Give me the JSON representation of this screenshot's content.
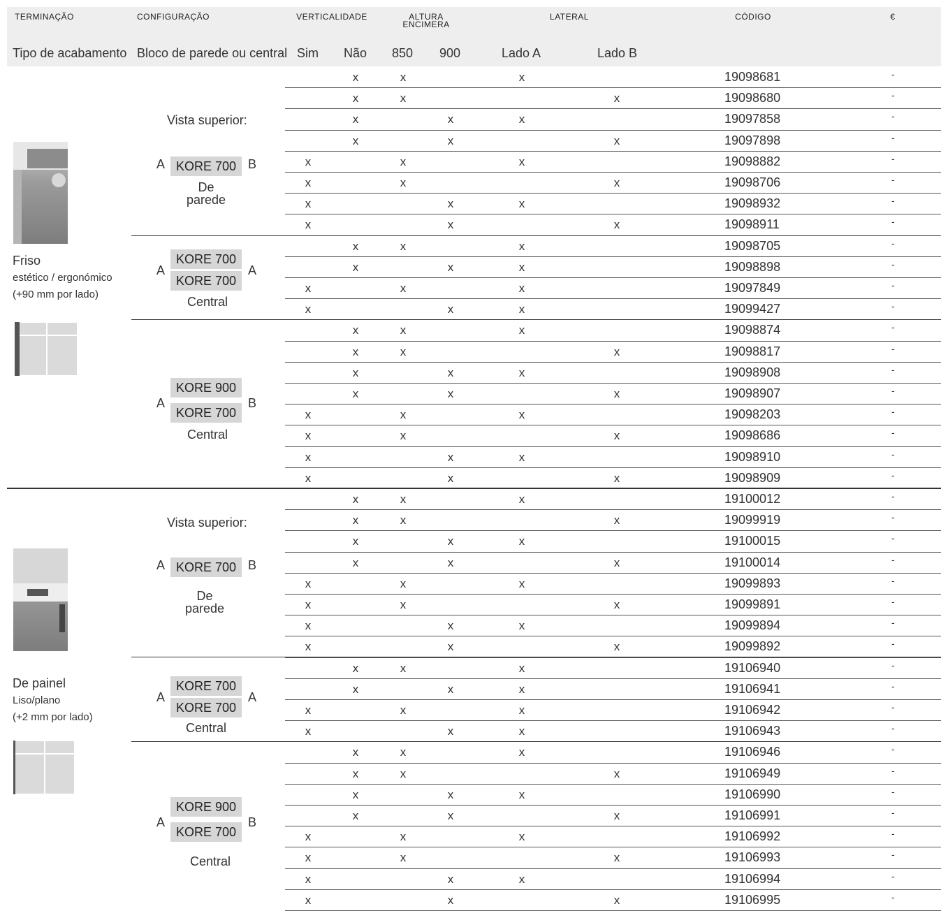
{
  "header": {
    "terminacao": "TERMINAÇÃO",
    "configuracao": "CONFIGURAÇÃO",
    "verticalidade": "VERTICALIDADE",
    "altura_1": "ALTURA",
    "altura_2": "ENCIMERA",
    "lateral": "LATERAL",
    "codigo": "CÓDIGO",
    "euro": "€",
    "sub_tipo": "Tipo de acabamento",
    "sub_bloco": "Bloco de parede ou central",
    "sub_sim": "Sim",
    "sub_nao": "Não",
    "sub_850": "850",
    "sub_900": "900",
    "sub_lado_a": "Lado A",
    "sub_lado_b": "Lado B"
  },
  "finishes": [
    {
      "title": "Friso",
      "sub1": "estético / ergonómico",
      "sub2": "(+90 mm por lado)"
    },
    {
      "title": "De painel",
      "sub1": "Liso/plano",
      "sub2": "(+2 mm por lado)"
    }
  ],
  "configs": {
    "vista": "Vista superior:",
    "side_a": "A",
    "side_b": "B",
    "kore700": "KORE 700",
    "kore900": "KORE 900",
    "de": "De",
    "parede": "parede",
    "central": "Central"
  },
  "rows": [
    {
      "v": "nao",
      "h": "850",
      "l": "A",
      "code": "19098681",
      "price": "-"
    },
    {
      "v": "nao",
      "h": "850",
      "l": "B",
      "code": "19098680",
      "price": "-"
    },
    {
      "v": "nao",
      "h": "900",
      "l": "A",
      "code": "19097858",
      "price": "-"
    },
    {
      "v": "nao",
      "h": "900",
      "l": "B",
      "code": "19097898",
      "price": "-"
    },
    {
      "v": "sim",
      "h": "850",
      "l": "A",
      "code": "19098882",
      "price": "-"
    },
    {
      "v": "sim",
      "h": "850",
      "l": "B",
      "code": "19098706",
      "price": "-"
    },
    {
      "v": "sim",
      "h": "900",
      "l": "A",
      "code": "19098932",
      "price": "-"
    },
    {
      "v": "sim",
      "h": "900",
      "l": "B",
      "code": "19098911",
      "price": "-"
    },
    {
      "v": "nao",
      "h": "850",
      "l": "A",
      "code": "19098705",
      "price": "-"
    },
    {
      "v": "nao",
      "h": "900",
      "l": "A",
      "code": "19098898",
      "price": "-"
    },
    {
      "v": "sim",
      "h": "850",
      "l": "A",
      "code": "19097849",
      "price": "-"
    },
    {
      "v": "sim",
      "h": "900",
      "l": "A",
      "code": "19099427",
      "price": "-"
    },
    {
      "v": "nao",
      "h": "850",
      "l": "A",
      "code": "19098874",
      "price": "-"
    },
    {
      "v": "nao",
      "h": "850",
      "l": "B",
      "code": "19098817",
      "price": "-"
    },
    {
      "v": "nao",
      "h": "900",
      "l": "A",
      "code": "19098908",
      "price": "-"
    },
    {
      "v": "nao",
      "h": "900",
      "l": "B",
      "code": "19098907",
      "price": "-"
    },
    {
      "v": "sim",
      "h": "850",
      "l": "A",
      "code": "19098203",
      "price": "-"
    },
    {
      "v": "sim",
      "h": "850",
      "l": "B",
      "code": "19098686",
      "price": "-"
    },
    {
      "v": "sim",
      "h": "900",
      "l": "A",
      "code": "19098910",
      "price": "-"
    },
    {
      "v": "sim",
      "h": "900",
      "l": "B",
      "code": "19098909",
      "price": "-"
    },
    {
      "v": "nao",
      "h": "850",
      "l": "A",
      "code": "19100012",
      "price": "-"
    },
    {
      "v": "nao",
      "h": "850",
      "l": "B",
      "code": "19099919",
      "price": "-"
    },
    {
      "v": "nao",
      "h": "900",
      "l": "A",
      "code": "19100015",
      "price": "-"
    },
    {
      "v": "nao",
      "h": "900",
      "l": "B",
      "code": "19100014",
      "price": "-"
    },
    {
      "v": "sim",
      "h": "850",
      "l": "A",
      "code": "19099893",
      "price": "-"
    },
    {
      "v": "sim",
      "h": "850",
      "l": "B",
      "code": "19099891",
      "price": "-"
    },
    {
      "v": "sim",
      "h": "900",
      "l": "A",
      "code": "19099894",
      "price": "-"
    },
    {
      "v": "sim",
      "h": "900",
      "l": "B",
      "code": "19099892",
      "price": "-"
    },
    {
      "v": "nao",
      "h": "850",
      "l": "A",
      "code": "19106940",
      "price": "-"
    },
    {
      "v": "nao",
      "h": "900",
      "l": "A",
      "code": "19106941",
      "price": "-"
    },
    {
      "v": "sim",
      "h": "850",
      "l": "A",
      "code": "19106942",
      "price": "-"
    },
    {
      "v": "sim",
      "h": "900",
      "l": "A",
      "code": "19106943",
      "price": "-"
    },
    {
      "v": "nao",
      "h": "850",
      "l": "A",
      "code": "19106946",
      "price": "-"
    },
    {
      "v": "nao",
      "h": "850",
      "l": "B",
      "code": "19106949",
      "price": "-"
    },
    {
      "v": "nao",
      "h": "900",
      "l": "A",
      "code": "19106990",
      "price": "-"
    },
    {
      "v": "nao",
      "h": "900",
      "l": "B",
      "code": "19106991",
      "price": "-"
    },
    {
      "v": "sim",
      "h": "850",
      "l": "A",
      "code": "19106992",
      "price": "-"
    },
    {
      "v": "sim",
      "h": "850",
      "l": "B",
      "code": "19106993",
      "price": "-"
    },
    {
      "v": "sim",
      "h": "900",
      "l": "A",
      "code": "19106994",
      "price": "-"
    },
    {
      "v": "sim",
      "h": "900",
      "l": "B",
      "code": "19106995",
      "price": "-"
    }
  ],
  "mark": "x"
}
